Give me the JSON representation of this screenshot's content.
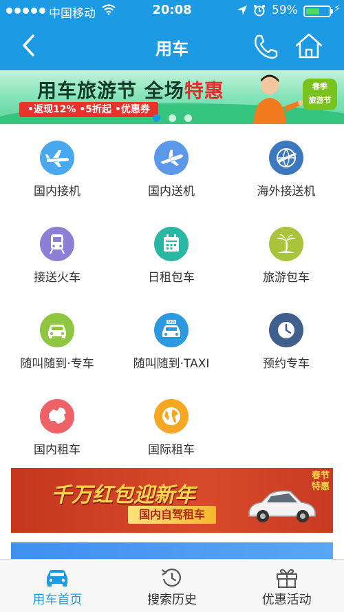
{
  "status_bar": {
    "carrier": "中国移动",
    "time": "20:08",
    "battery_percent": "59%",
    "battery_level": 0.59,
    "icons": [
      "signal-dots-icon",
      "wifi-icon",
      "location-arrow-icon",
      "alarm-clock-icon",
      "battery-icon",
      "charging-bolt-icon"
    ]
  },
  "nav": {
    "title": "用车",
    "icons": [
      "back-chevron-icon",
      "phone-icon",
      "home-icon"
    ]
  },
  "top_banner": {
    "headline_main": "用车旅游节 全场",
    "headline_hot": "特惠",
    "chips": "•返现12%  •5折起  •优惠券",
    "badge_line1": "春季",
    "badge_line2": "旅游节",
    "page_count": 3,
    "active_page": 1
  },
  "services": [
    {
      "label": "国内接机",
      "icon": "plane-arrival-icon",
      "color": "#4aa8f0"
    },
    {
      "label": "国内送机",
      "icon": "plane-departure-icon",
      "color": "#5b98ea"
    },
    {
      "label": "海外接送机",
      "icon": "globe-plane-icon",
      "color": "#3b78c0"
    },
    {
      "label": "接送火车",
      "icon": "train-icon",
      "color": "#8b7fd6"
    },
    {
      "label": "日租包车",
      "icon": "calendar-icon",
      "color": "#29b7a4"
    },
    {
      "label": "旅游包车",
      "icon": "palm-tree-icon",
      "color": "#a9c43a"
    },
    {
      "label": "随叫随到·专车",
      "icon": "car-icon",
      "color": "#8ec640"
    },
    {
      "label": "随叫随到·TAXI",
      "icon": "taxi-icon",
      "color": "#2a99e0"
    },
    {
      "label": "预约专车",
      "icon": "clock-icon",
      "color": "#3f5f8f"
    },
    {
      "label": "国内租车",
      "icon": "china-map-icon",
      "color": "#ee6167"
    },
    {
      "label": "国际租车",
      "icon": "world-globe-icon",
      "color": "#f5a623"
    }
  ],
  "promo_banner": {
    "headline": "千万红包迎新年",
    "subline": "国内自驾租车",
    "corner_line1": "春节",
    "corner_line2": "特惠"
  },
  "tabs": [
    {
      "label": "用车首页",
      "icon": "car-tab-icon",
      "active": true
    },
    {
      "label": "搜索历史",
      "icon": "history-clock-icon",
      "active": false
    },
    {
      "label": "优惠活动",
      "icon": "gift-icon",
      "active": false
    }
  ],
  "colors": {
    "brand": "#1c9ae4",
    "promo_red": "#d94a2a",
    "banner_green": "#5ed39f"
  }
}
